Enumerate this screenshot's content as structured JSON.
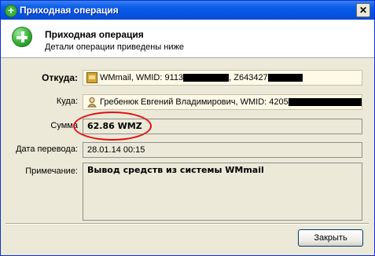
{
  "window": {
    "title": "Приходная операция",
    "close_label": "✕"
  },
  "header": {
    "title": "Приходная операция",
    "subtitle": "Детали операции приведены ниже"
  },
  "fields": {
    "from": {
      "label": "Откуда:",
      "value_prefix": "WMmail, WMID: 9113",
      "value_mid": ", Z643427"
    },
    "to": {
      "label": "Куда:",
      "value_prefix": "Гребенюк Евгений Владимирович, WMID: 4205"
    },
    "amount": {
      "label": "Сумма",
      "value": "62.86 WMZ"
    },
    "date": {
      "label": "Дата перевода:",
      "value": "28.01.14 00:15"
    },
    "note": {
      "label": "Примечание:",
      "value": "Вывод средств из системы WMmail"
    }
  },
  "buttons": {
    "close": "Закрыть"
  },
  "colors": {
    "annotation": "#e01010",
    "title_bar": "#0554e3"
  }
}
